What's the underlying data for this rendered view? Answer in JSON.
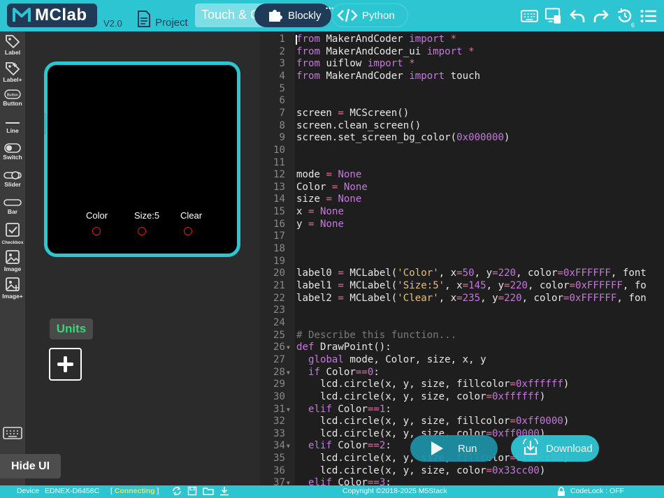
{
  "app": {
    "logo_text": "MClab",
    "version": "V2.0",
    "project_label": "Project",
    "tabs": {
      "touch": "Touch & C",
      "blockly": "Blockly",
      "python": "Python"
    },
    "history_count": "6",
    "accent_color": "#2ec5d3",
    "dark_color": "#1f3b57",
    "top_icons": [
      "keyboard-icon",
      "device-icon",
      "undo-icon",
      "redo-icon",
      "history-icon",
      "menu-icon"
    ]
  },
  "toolbar": {
    "items": [
      {
        "label": "Label",
        "icon": "tag-icon"
      },
      {
        "label": "Label+",
        "icon": "tag-plus-icon"
      },
      {
        "label": "Button",
        "icon": "button-icon",
        "inner": "Button"
      },
      {
        "label": "Line",
        "icon": "line-icon"
      },
      {
        "label": "Switch",
        "icon": "switch-icon"
      },
      {
        "label": "Slider",
        "icon": "slider-icon"
      },
      {
        "label": "Bar",
        "icon": "bar-icon"
      },
      {
        "label": "Checkbox",
        "icon": "checkbox-icon"
      },
      {
        "label": "Image",
        "icon": "image-icon"
      },
      {
        "label": "Image+",
        "icon": "image-plus-icon"
      }
    ]
  },
  "screen": {
    "labels": [
      "Color",
      "Size:5",
      "Clear"
    ]
  },
  "units": {
    "label": "Units"
  },
  "hide_ui": "Hide UI",
  "editor": {
    "lines": [
      "from MakerAndCoder import *",
      "from MakerAndCoder_ui import *",
      "from uiflow import *",
      "from MakerAndCoder import touch",
      "",
      "",
      "screen = MCScreen()",
      "screen.clean_screen()",
      "screen.set_screen_bg_color(0x000000)",
      "",
      "",
      "mode = None",
      "Color = None",
      "size = None",
      "x = None",
      "y = None",
      "",
      "",
      "",
      "label0 = MCLabel('Color', x=50, y=220, color=0xFFFFFF, font",
      "label1 = MCLabel('Size:5', x=145, y=220, color=0xFFFFFF, fo",
      "label2 = MCLabel('Clear', x=235, y=220, color=0xFFFFFF, fon",
      "",
      "",
      "# Describe this function...",
      "def DrawPoint():",
      "  global mode, Color, size, x, y",
      "  if Color==0:",
      "    lcd.circle(x, y, size, fillcolor=0xffffff)",
      "    lcd.circle(x, y, size, color=0xffffff)",
      "  elif Color==1:",
      "    lcd.circle(x, y, size, fillcolor=0xff0000)",
      "    lcd.circle(x, y, size, color=0xff0000)",
      "  elif Color==2:",
      "    lcd.circle(x, y, size, fillcolor=0x33cc00)",
      "    lcd.circle(x, y, size, color=0x33cc00)",
      "  elif Color==3:"
    ],
    "fold_lines": [
      26,
      28,
      31,
      34,
      37
    ]
  },
  "actions": {
    "run": "Run",
    "download": "Download"
  },
  "status": {
    "device_label": "Device",
    "device_id": "EDNEX-D6458C",
    "connection": "Connecting",
    "copyright": "Copyright ©2018-2025 M5Stack",
    "codelock": "CodeLock : OFF"
  }
}
